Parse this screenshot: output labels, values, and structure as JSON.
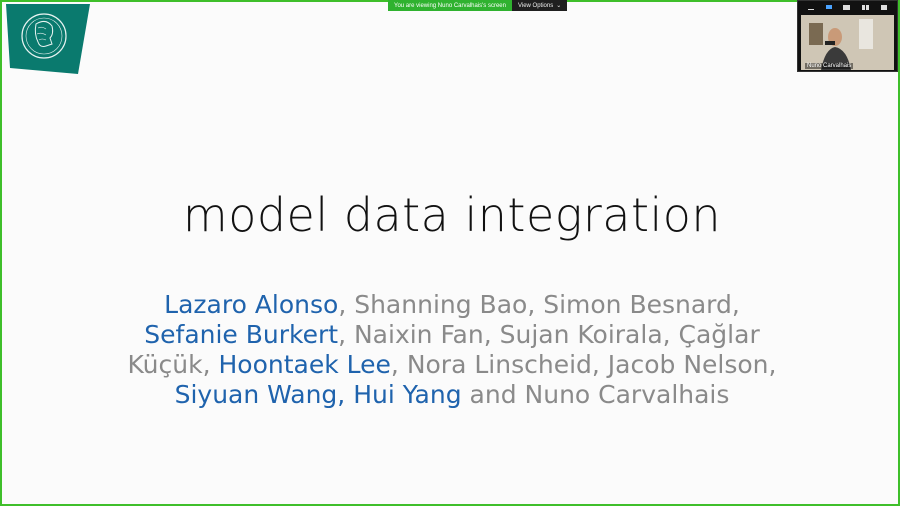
{
  "screen_share": {
    "viewing_text": "You are viewing Nuno Carvalhais's screen",
    "view_options_label": "View Options"
  },
  "slide": {
    "title": "model data integration",
    "authors_lines": [
      [
        {
          "t": "Lazaro Alonso",
          "hl": true
        },
        {
          "t": ", Shanning Bao, Simon Besnard,",
          "hl": false
        }
      ],
      [
        {
          "t": "Sefanie Burkert",
          "hl": true
        },
        {
          "t": ", Naixin Fan, Sujan Koirala, Çağlar",
          "hl": false
        }
      ],
      [
        {
          "t": "Küçük, ",
          "hl": false
        },
        {
          "t": "Hoontaek Lee",
          "hl": true
        },
        {
          "t": ", Nora Linscheid, Jacob Nelson,",
          "hl": false
        }
      ],
      [
        {
          "t": "Siyuan Wang, Hui Yang",
          "hl": true
        },
        {
          "t": " and Nuno Carvalhais",
          "hl": false
        }
      ]
    ],
    "colors": {
      "highlight": "#1f63ad",
      "normal": "#8a8a8a",
      "logo": "#0a7a6e"
    }
  },
  "participant": {
    "name": "Nuno Carvalhais"
  }
}
